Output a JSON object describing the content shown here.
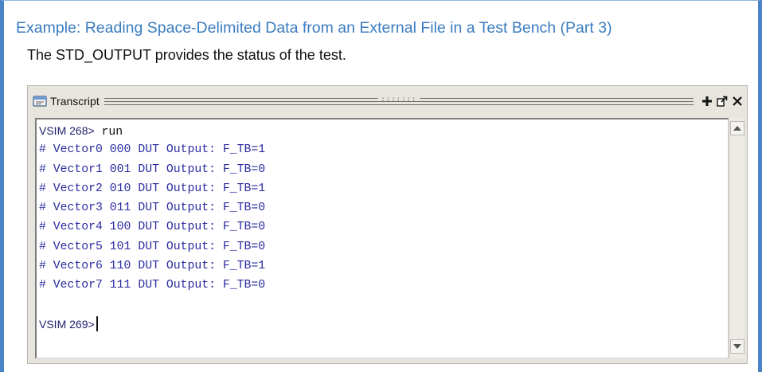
{
  "slide": {
    "title": "Example: Reading Space-Delimited Data from an External File in a Test Bench (Part 3)",
    "subtitle": "The STD_OUTPUT provides the status of the test."
  },
  "window": {
    "title": "Transcript",
    "grip": ":::::::",
    "buttons": [
      "add-icon",
      "undock-icon",
      "close-icon"
    ]
  },
  "console": {
    "first_prompt": "VSIM 268>",
    "first_command": " run",
    "output_lines": [
      "# Vector0 000 DUT Output: F_TB=1",
      "# Vector1 001 DUT Output: F_TB=0",
      "# Vector2 010 DUT Output: F_TB=1",
      "# Vector3 011 DUT Output: F_TB=0",
      "# Vector4 100 DUT Output: F_TB=0",
      "# Vector5 101 DUT Output: F_TB=0",
      "# Vector6 110 DUT Output: F_TB=1",
      "# Vector7 111 DUT Output: F_TB=0"
    ],
    "second_prompt": "VSIM 269>"
  },
  "colors": {
    "title_blue": "#3b7cc0",
    "frame_blue": "#4a84c4",
    "output_blue": "#2a2aa0"
  }
}
